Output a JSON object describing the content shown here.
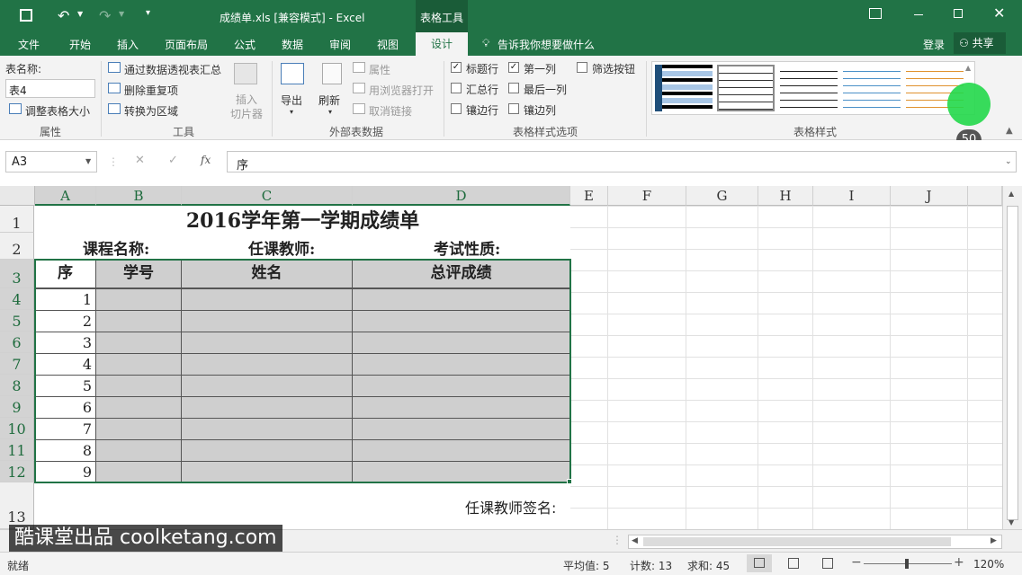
{
  "window": {
    "title": "成绩单.xls  [兼容模式] - Excel",
    "context_tab": "表格工具"
  },
  "tabs": [
    "文件",
    "开始",
    "插入",
    "页面布局",
    "公式",
    "数据",
    "审阅",
    "视图",
    "设计"
  ],
  "tell_me": "告诉我你想要做什么",
  "login": "登录",
  "share": "共享",
  "ribbon": {
    "props": {
      "name_label": "表名称:",
      "name_value": "表4",
      "resize": "调整表格大小",
      "group": "属性"
    },
    "tools": {
      "pivot": "通过数据透视表汇总",
      "dedupe": "删除重复项",
      "convert": "转换为区域",
      "slicer1": "插入",
      "slicer2": "切片器",
      "group": "工具"
    },
    "external": {
      "export": "导出",
      "refresh": "刷新",
      "properties": "属性",
      "browser": "用浏览器打开",
      "unlink": "取消链接",
      "group": "外部表数据"
    },
    "options": {
      "header_row": "标题行",
      "total_row": "汇总行",
      "banded_rows": "镶边行",
      "first_col": "第一列",
      "last_col": "最后一列",
      "banded_cols": "镶边列",
      "filter_btn": "筛选按钮",
      "group": "表格样式选项"
    },
    "styles": {
      "group": "表格样式"
    }
  },
  "badge": "50",
  "formula": {
    "name_box": "A3",
    "fx": "fx",
    "content": "序"
  },
  "columns": [
    "A",
    "B",
    "C",
    "D",
    "E",
    "F",
    "G",
    "H",
    "I",
    "J"
  ],
  "rows": [
    "1",
    "2",
    "3",
    "4",
    "5",
    "6",
    "7",
    "8",
    "9",
    "10",
    "11",
    "12",
    "13"
  ],
  "sheet": {
    "title": "2016学年第一学期成绩单",
    "course": "课程名称:",
    "teacher": "任课教师:",
    "exam": "考试性质:",
    "headers": [
      "序",
      "学号",
      "姓名",
      "总评成绩"
    ],
    "seq": [
      "1",
      "2",
      "3",
      "4",
      "5",
      "6",
      "7",
      "8",
      "9"
    ],
    "signature": "任课教师签名:"
  },
  "watermark": "酷课堂出品 coolketang.com",
  "status": {
    "ready": "就绪",
    "avg": "平均值: 5",
    "count": "计数: 13",
    "sum": "求和: 45",
    "zoom": "120%"
  }
}
